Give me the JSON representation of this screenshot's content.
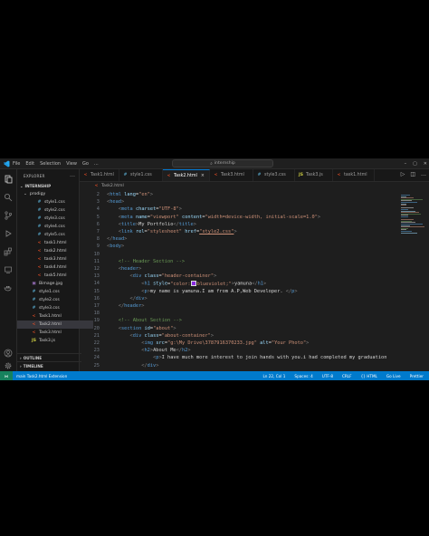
{
  "titlebar": {
    "menu": [
      "File",
      "Edit",
      "Selection",
      "View",
      "Go",
      "..."
    ],
    "search_text": "internship"
  },
  "sidebar": {
    "explorer_title": "EXPLORER",
    "workspace": "INTERNSHIP",
    "folder": "prodigy",
    "files": [
      {
        "name": "style1.css",
        "kind": "css"
      },
      {
        "name": "style2.css",
        "kind": "css"
      },
      {
        "name": "style3.css",
        "kind": "css"
      },
      {
        "name": "style4.css",
        "kind": "css"
      },
      {
        "name": "style5.css",
        "kind": "css"
      },
      {
        "name": "task1.html",
        "kind": "html"
      },
      {
        "name": "task2.html",
        "kind": "html"
      },
      {
        "name": "task3.html",
        "kind": "html"
      },
      {
        "name": "task4.html",
        "kind": "html"
      },
      {
        "name": "task5.html",
        "kind": "html"
      },
      {
        "name": "Bimage.jpg",
        "kind": "img"
      },
      {
        "name": "style1.css",
        "kind": "css"
      },
      {
        "name": "style2.css",
        "kind": "css"
      },
      {
        "name": "style3.css",
        "kind": "css"
      },
      {
        "name": "Task1.html",
        "kind": "html"
      },
      {
        "name": "Task2.html",
        "kind": "html",
        "active": true
      },
      {
        "name": "Task3.html",
        "kind": "html"
      },
      {
        "name": "Task3.js",
        "kind": "js"
      }
    ],
    "outline_label": "OUTLINE",
    "timeline_label": "TIMELINE"
  },
  "tabs": [
    {
      "label": "Task1.html",
      "kind": "html"
    },
    {
      "label": "style1.css",
      "kind": "css"
    },
    {
      "label": "Task2.html",
      "kind": "html",
      "active": true
    },
    {
      "label": "Task3.html",
      "kind": "html"
    },
    {
      "label": "style3.css",
      "kind": "css"
    },
    {
      "label": "Task3.js",
      "kind": "js"
    },
    {
      "label": "task1.html",
      "kind": "html"
    }
  ],
  "breadcrumb": "Task2.html",
  "editor": {
    "line_numbers": [
      "2",
      "3",
      "4",
      "5",
      "6",
      "7",
      "8",
      "9",
      "10",
      "11",
      "12",
      "13",
      "14",
      "15",
      "16",
      "17",
      "18",
      "19",
      "20",
      "21",
      "22",
      "23",
      "24",
      "25"
    ]
  },
  "statusbar": {
    "left": "main  Task2.html  Extension",
    "items": [
      "Ln 22, Col 1",
      "Spaces: 4",
      "UTF-8",
      "CRLF",
      "{} HTML",
      "Go Live",
      "Prettier"
    ]
  },
  "colors": {
    "editor_bg": "#1e1e1e",
    "status_bg": "#007acc",
    "accent": "#0078d4",
    "swatch": "#8a2be2"
  }
}
